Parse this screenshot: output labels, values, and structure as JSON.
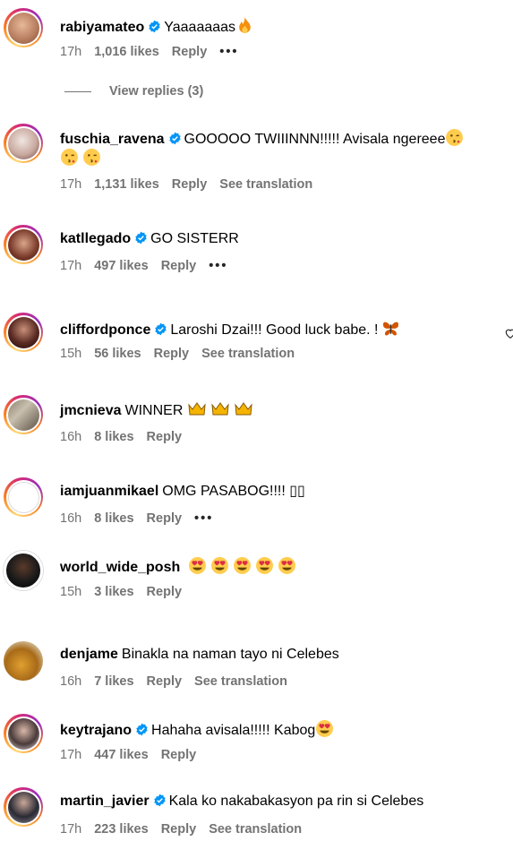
{
  "comments": [
    {
      "user": "rabiyamateo",
      "verified": true,
      "text": "Yaaaaaaas",
      "time": "17h",
      "likes": "1,016 likes",
      "reply": "Reply",
      "translate": "",
      "more": true
    },
    {
      "user": "fuschia_ravena",
      "verified": true,
      "text": "GOOOOO TWIIINNN!!!!! Avisala ngereee",
      "time": "17h",
      "likes": "1,131 likes",
      "reply": "Reply",
      "translate": "See translation",
      "more": false
    },
    {
      "user": "katllegado",
      "verified": true,
      "text": "GO SISTERR",
      "time": "17h",
      "likes": "497 likes",
      "reply": "Reply",
      "translate": "",
      "more": true
    },
    {
      "user": "cliffordponce",
      "verified": true,
      "text": "Laroshi Dzai!!! Good luck babe. !",
      "time": "15h",
      "likes": "56 likes",
      "reply": "Reply",
      "translate": "See translation",
      "more": false
    },
    {
      "user": "jmcnieva",
      "verified": false,
      "text": "WINNER",
      "time": "16h",
      "likes": "8 likes",
      "reply": "Reply",
      "translate": "",
      "more": false
    },
    {
      "user": "iamjuanmikael",
      "verified": false,
      "text": "OMG PASABOG!!!! ▯▯",
      "time": "16h",
      "likes": "8 likes",
      "reply": "Reply",
      "translate": "",
      "more": true
    },
    {
      "user": "world_wide_posh",
      "verified": false,
      "text": "",
      "time": "15h",
      "likes": "3 likes",
      "reply": "Reply",
      "translate": "",
      "more": false
    },
    {
      "user": "denjame",
      "verified": false,
      "text": "Binakla na naman tayo ni Celebes",
      "time": "16h",
      "likes": "7 likes",
      "reply": "Reply",
      "translate": "See translation",
      "more": false
    },
    {
      "user": "keytrajano",
      "verified": true,
      "text": "Hahaha avisala!!!!! Kabog",
      "time": "17h",
      "likes": "447 likes",
      "reply": "Reply",
      "translate": "",
      "more": false
    },
    {
      "user": "martin_javier",
      "verified": true,
      "text": "Kala ko nakabakasyon pa rin si Celebes",
      "time": "17h",
      "likes": "223 likes",
      "reply": "Reply",
      "translate": "See translation",
      "more": false
    }
  ],
  "view_replies": "View replies (3)",
  "more_label": "•••",
  "colors": {
    "verified": "#0095f6",
    "meta": "#737373"
  }
}
